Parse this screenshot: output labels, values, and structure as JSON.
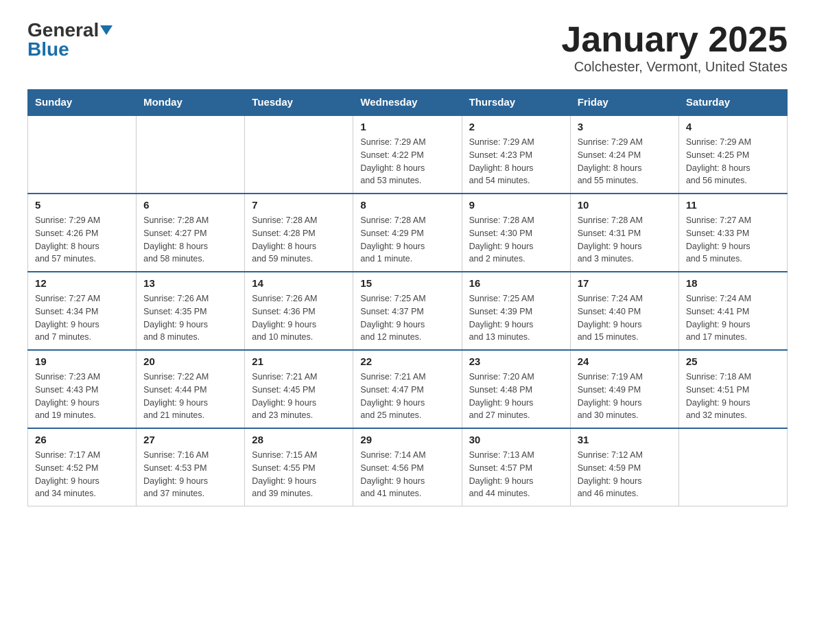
{
  "header": {
    "logo_general": "General",
    "logo_blue": "Blue",
    "title": "January 2025",
    "subtitle": "Colchester, Vermont, United States"
  },
  "days_of_week": [
    "Sunday",
    "Monday",
    "Tuesday",
    "Wednesday",
    "Thursday",
    "Friday",
    "Saturday"
  ],
  "weeks": [
    {
      "days": [
        {
          "num": "",
          "info": ""
        },
        {
          "num": "",
          "info": ""
        },
        {
          "num": "",
          "info": ""
        },
        {
          "num": "1",
          "info": "Sunrise: 7:29 AM\nSunset: 4:22 PM\nDaylight: 8 hours\nand 53 minutes."
        },
        {
          "num": "2",
          "info": "Sunrise: 7:29 AM\nSunset: 4:23 PM\nDaylight: 8 hours\nand 54 minutes."
        },
        {
          "num": "3",
          "info": "Sunrise: 7:29 AM\nSunset: 4:24 PM\nDaylight: 8 hours\nand 55 minutes."
        },
        {
          "num": "4",
          "info": "Sunrise: 7:29 AM\nSunset: 4:25 PM\nDaylight: 8 hours\nand 56 minutes."
        }
      ]
    },
    {
      "days": [
        {
          "num": "5",
          "info": "Sunrise: 7:29 AM\nSunset: 4:26 PM\nDaylight: 8 hours\nand 57 minutes."
        },
        {
          "num": "6",
          "info": "Sunrise: 7:28 AM\nSunset: 4:27 PM\nDaylight: 8 hours\nand 58 minutes."
        },
        {
          "num": "7",
          "info": "Sunrise: 7:28 AM\nSunset: 4:28 PM\nDaylight: 8 hours\nand 59 minutes."
        },
        {
          "num": "8",
          "info": "Sunrise: 7:28 AM\nSunset: 4:29 PM\nDaylight: 9 hours\nand 1 minute."
        },
        {
          "num": "9",
          "info": "Sunrise: 7:28 AM\nSunset: 4:30 PM\nDaylight: 9 hours\nand 2 minutes."
        },
        {
          "num": "10",
          "info": "Sunrise: 7:28 AM\nSunset: 4:31 PM\nDaylight: 9 hours\nand 3 minutes."
        },
        {
          "num": "11",
          "info": "Sunrise: 7:27 AM\nSunset: 4:33 PM\nDaylight: 9 hours\nand 5 minutes."
        }
      ]
    },
    {
      "days": [
        {
          "num": "12",
          "info": "Sunrise: 7:27 AM\nSunset: 4:34 PM\nDaylight: 9 hours\nand 7 minutes."
        },
        {
          "num": "13",
          "info": "Sunrise: 7:26 AM\nSunset: 4:35 PM\nDaylight: 9 hours\nand 8 minutes."
        },
        {
          "num": "14",
          "info": "Sunrise: 7:26 AM\nSunset: 4:36 PM\nDaylight: 9 hours\nand 10 minutes."
        },
        {
          "num": "15",
          "info": "Sunrise: 7:25 AM\nSunset: 4:37 PM\nDaylight: 9 hours\nand 12 minutes."
        },
        {
          "num": "16",
          "info": "Sunrise: 7:25 AM\nSunset: 4:39 PM\nDaylight: 9 hours\nand 13 minutes."
        },
        {
          "num": "17",
          "info": "Sunrise: 7:24 AM\nSunset: 4:40 PM\nDaylight: 9 hours\nand 15 minutes."
        },
        {
          "num": "18",
          "info": "Sunrise: 7:24 AM\nSunset: 4:41 PM\nDaylight: 9 hours\nand 17 minutes."
        }
      ]
    },
    {
      "days": [
        {
          "num": "19",
          "info": "Sunrise: 7:23 AM\nSunset: 4:43 PM\nDaylight: 9 hours\nand 19 minutes."
        },
        {
          "num": "20",
          "info": "Sunrise: 7:22 AM\nSunset: 4:44 PM\nDaylight: 9 hours\nand 21 minutes."
        },
        {
          "num": "21",
          "info": "Sunrise: 7:21 AM\nSunset: 4:45 PM\nDaylight: 9 hours\nand 23 minutes."
        },
        {
          "num": "22",
          "info": "Sunrise: 7:21 AM\nSunset: 4:47 PM\nDaylight: 9 hours\nand 25 minutes."
        },
        {
          "num": "23",
          "info": "Sunrise: 7:20 AM\nSunset: 4:48 PM\nDaylight: 9 hours\nand 27 minutes."
        },
        {
          "num": "24",
          "info": "Sunrise: 7:19 AM\nSunset: 4:49 PM\nDaylight: 9 hours\nand 30 minutes."
        },
        {
          "num": "25",
          "info": "Sunrise: 7:18 AM\nSunset: 4:51 PM\nDaylight: 9 hours\nand 32 minutes."
        }
      ]
    },
    {
      "days": [
        {
          "num": "26",
          "info": "Sunrise: 7:17 AM\nSunset: 4:52 PM\nDaylight: 9 hours\nand 34 minutes."
        },
        {
          "num": "27",
          "info": "Sunrise: 7:16 AM\nSunset: 4:53 PM\nDaylight: 9 hours\nand 37 minutes."
        },
        {
          "num": "28",
          "info": "Sunrise: 7:15 AM\nSunset: 4:55 PM\nDaylight: 9 hours\nand 39 minutes."
        },
        {
          "num": "29",
          "info": "Sunrise: 7:14 AM\nSunset: 4:56 PM\nDaylight: 9 hours\nand 41 minutes."
        },
        {
          "num": "30",
          "info": "Sunrise: 7:13 AM\nSunset: 4:57 PM\nDaylight: 9 hours\nand 44 minutes."
        },
        {
          "num": "31",
          "info": "Sunrise: 7:12 AM\nSunset: 4:59 PM\nDaylight: 9 hours\nand 46 minutes."
        },
        {
          "num": "",
          "info": ""
        }
      ]
    }
  ]
}
